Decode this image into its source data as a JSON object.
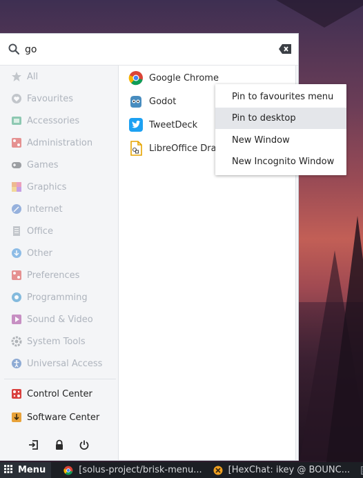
{
  "search": {
    "value": "go",
    "placeholder": ""
  },
  "categories": [
    {
      "label": "All",
      "icon": "all-star-icon",
      "color": "#9aa0a8"
    },
    {
      "label": "Favourites",
      "icon": "favourites-heart-icon",
      "color": "#9aa0a8"
    },
    {
      "label": "Accessories",
      "icon": "accessories-icon",
      "color": "#3aa57a"
    },
    {
      "label": "Administration",
      "icon": "administration-icon",
      "color": "#d9413f"
    },
    {
      "label": "Games",
      "icon": "games-gamepad-icon",
      "color": "#55595f"
    },
    {
      "label": "Graphics",
      "icon": "graphics-palette-icon",
      "color": "#e98a3c"
    },
    {
      "label": "Internet",
      "icon": "internet-globe-icon",
      "color": "#4b7ac8"
    },
    {
      "label": "Office",
      "icon": "office-document-icon",
      "color": "#9aa0a8"
    },
    {
      "label": "Other",
      "icon": "other-download-icon",
      "color": "#3a8fd9"
    },
    {
      "label": "Preferences",
      "icon": "preferences-icon",
      "color": "#d9413f"
    },
    {
      "label": "Programming",
      "icon": "programming-gear-icon",
      "color": "#2a8bc9"
    },
    {
      "label": "Sound & Video",
      "icon": "sound-video-play-icon",
      "color": "#a43d9a"
    },
    {
      "label": "System Tools",
      "icon": "system-tools-gear-icon",
      "color": "#7a7f86"
    },
    {
      "label": "Universal Access",
      "icon": "universal-access-icon",
      "color": "#3c6fb8"
    }
  ],
  "fixed_items": [
    {
      "label": "Control Center",
      "icon": "control-center-icon",
      "color": "#d9413f"
    },
    {
      "label": "Software Center",
      "icon": "software-center-icon",
      "color": "#e8a23a"
    }
  ],
  "bottom_actions": [
    "logout-icon",
    "lock-icon",
    "power-icon"
  ],
  "results": [
    {
      "label": "Google Chrome",
      "icon": "google-chrome-icon"
    },
    {
      "label": "Godot",
      "icon": "godot-icon"
    },
    {
      "label": "TweetDeck",
      "icon": "tweetdeck-icon"
    },
    {
      "label": "LibreOffice Draw",
      "icon": "libreoffice-draw-icon"
    }
  ],
  "context_menu": {
    "items": [
      {
        "label": "Pin to favourites menu"
      },
      {
        "label": "Pin to desktop"
      },
      {
        "label": "New Window"
      },
      {
        "label": "New Incognito Window"
      }
    ],
    "highlighted_index": 1
  },
  "taskbar": {
    "menu_label": "Menu",
    "tasks": [
      {
        "label": "[solus-project/brisk-menu...",
        "icon": "chrome-icon"
      },
      {
        "label": "[HexChat: ikey @ BOUNC...",
        "icon": "hexchat-icon"
      },
      {
        "label": "[m",
        "icon": "terminal-icon"
      }
    ]
  },
  "colors": {
    "accent_red": "#d9413f",
    "highlight": "#e4e6ea",
    "taskbar_bg": "#1c1f24"
  }
}
